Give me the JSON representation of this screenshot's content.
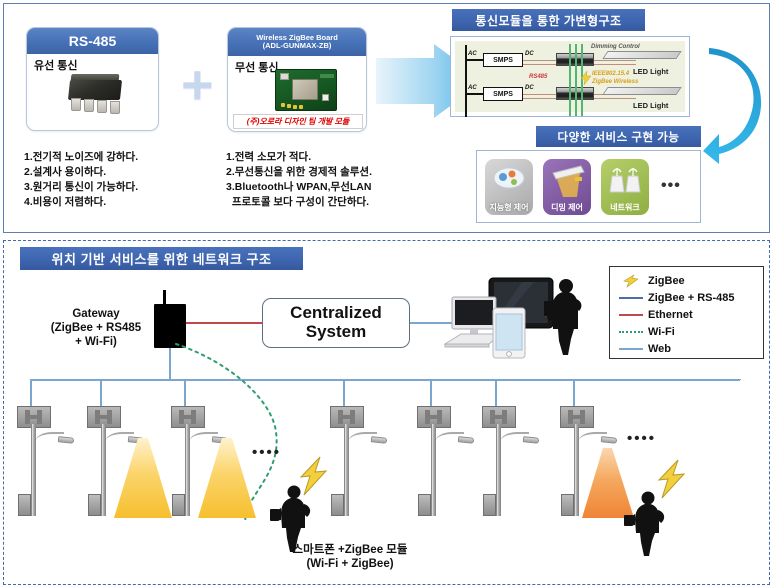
{
  "top_section": {
    "rs485_card": {
      "title": "RS-485",
      "subtitle": "유선 통신",
      "icon": "dip-chip-icon",
      "bullets": "1.전기적 노이즈에 강하다.\n2.설계사 용이하다.\n3.원거리 통신이 가능하다.\n4.비용이 저렴하다."
    },
    "plus_symbol": "+",
    "zigbee_card": {
      "title_line1": "Wireless ZigBee Board",
      "title_line2": "(ADL-GUNMAX-ZB)",
      "subtitle": "무선 통신",
      "icon": "zigbee-pcb-icon",
      "red_band": "(주)오로라 디자인 팀 개발 모듈",
      "bullets": "1.전력 소모가 적다.\n2.무선통신을 위한 경제적 솔루션.\n3.Bluetooth나 WPAN,무선LAN\n  프로토콜 보다 구성이 간단하다."
    },
    "variable_structure": {
      "title": "통신모듈을 통한 가변형구조",
      "labels": {
        "ac": "AC",
        "dc": "DC",
        "smps": "SMPS",
        "dimming": "Dimming Control",
        "rs485": "RS485",
        "zigbee_std": "IEEE802.15.4",
        "zigbee_wireless": "ZigBee Wireless",
        "led1": "LED Light",
        "led2": "LED Light"
      }
    },
    "services": {
      "title": "다양한 서비스 구현 가능",
      "items": [
        {
          "label": "지능형\n제어",
          "icon": "cloud-service-icon"
        },
        {
          "label": "디밍 제어",
          "icon": "dimming-lamp-icon"
        },
        {
          "label": "네트워크",
          "icon": "network-lamp-icon"
        }
      ],
      "ellipsis": "•••"
    }
  },
  "bottom_section": {
    "title": "위치 기반 서비스를 위한 네트워크 구조",
    "gateway_label": "Gateway\n(ZigBee + RS485\n+ Wi-Fi)",
    "centralized_system": "Centralized\nSystem",
    "smartphone_caption": "스마트폰 +ZigBee 모듈\n(Wi-Fi + ZigBee)",
    "ellipsis_left": "••••",
    "ellipsis_right": "••••",
    "legend": {
      "items": [
        {
          "label": "ZigBee",
          "key": "bolt-icon",
          "color": "#e8c33a"
        },
        {
          "label": "ZigBee + RS-485",
          "key": "line",
          "color": "#4a6fa5"
        },
        {
          "label": "Ethernet",
          "key": "line",
          "color": "#c04a4a"
        },
        {
          "label": "Wi-Fi",
          "key": "dotted",
          "color": "#2f9e6e"
        },
        {
          "label": "Web",
          "key": "line",
          "color": "#7ba7cf"
        }
      ]
    },
    "poles": [
      {
        "cone": "none"
      },
      {
        "cone": "yellow"
      },
      {
        "cone": "yellow"
      },
      {
        "cone": "none"
      },
      {
        "cone": "none"
      },
      {
        "cone": "orange"
      }
    ],
    "devices": [
      "desktop-monitor-icon",
      "tablet-icon",
      "smartphone-icon",
      "person-icon"
    ]
  },
  "colors": {
    "header_blue": "#4671b6",
    "frame_blue": "#4169b0",
    "arrow_blue": "#29a8df",
    "ethernet_red": "#c04a4a",
    "wifi_green": "#2f9e6e",
    "web_blue": "#7ba7cf",
    "zigbee_yellow": "#e8c33a",
    "cone_yellow": "#f6c33c",
    "cone_orange": "#f08a3c"
  }
}
